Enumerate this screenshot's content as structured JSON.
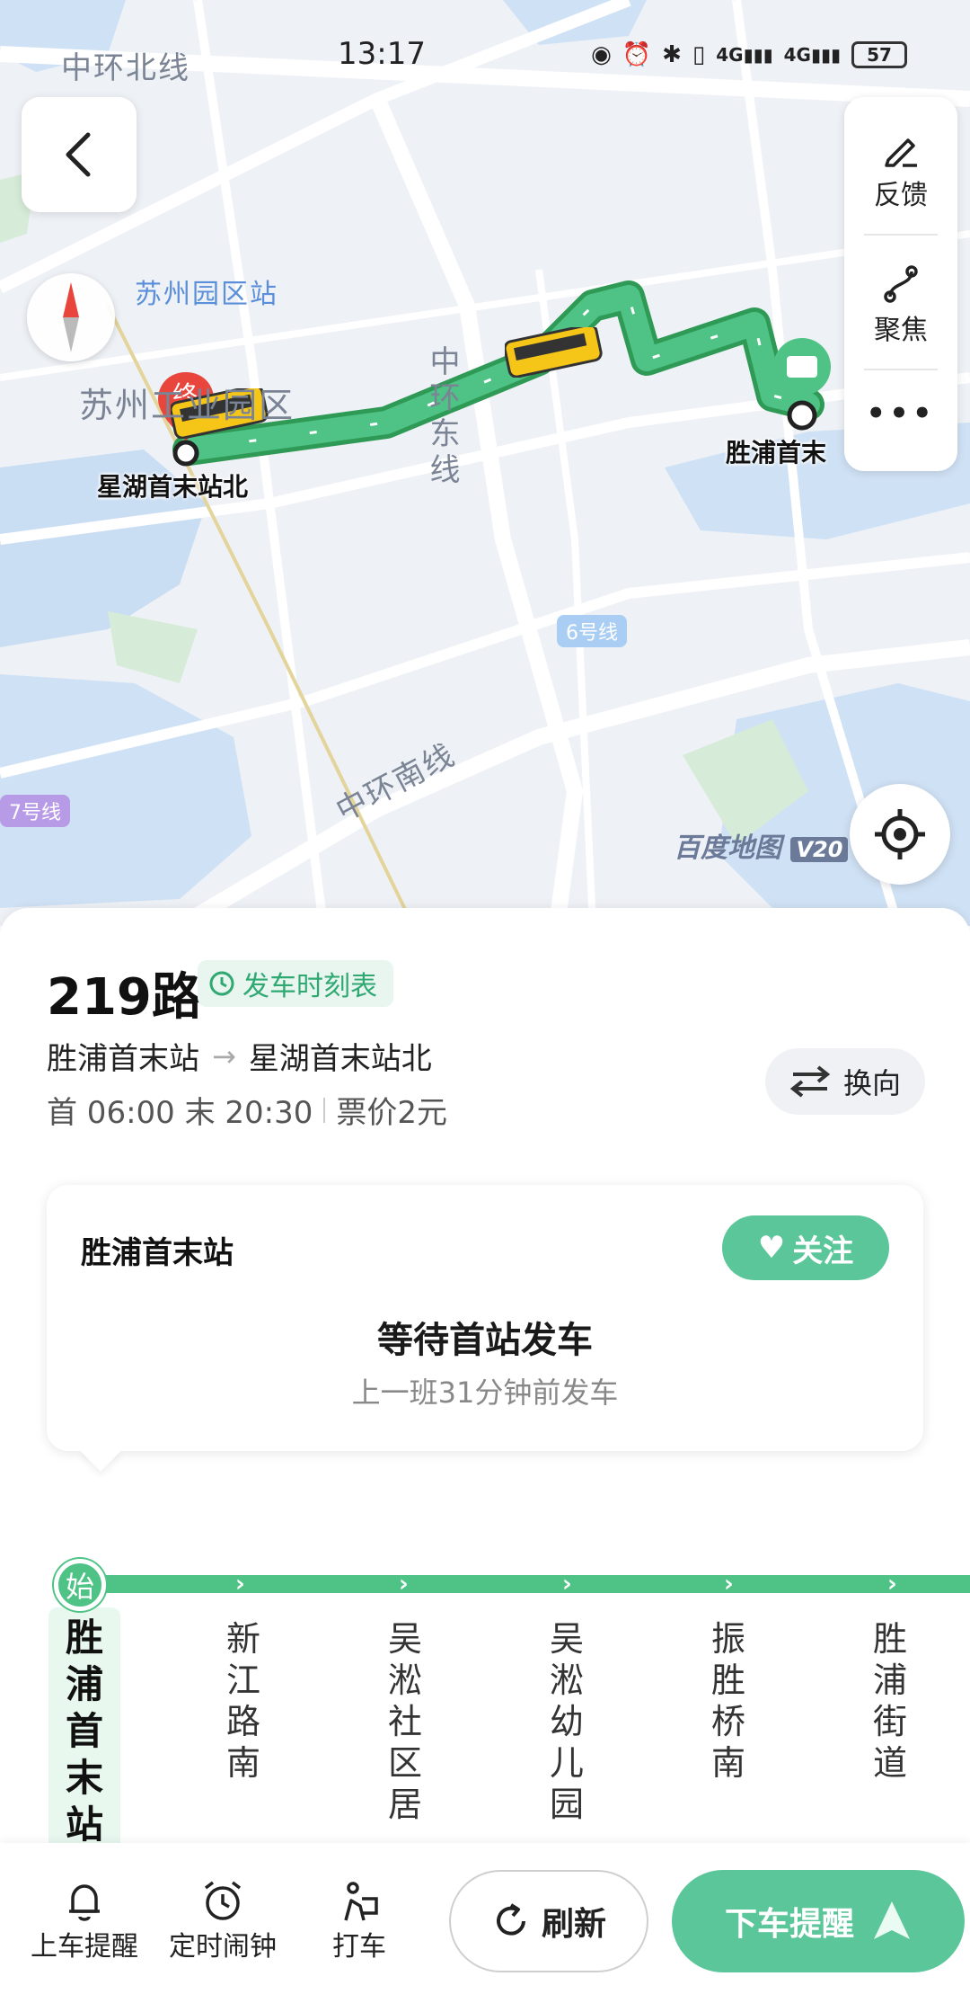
{
  "status": {
    "time": "13:17",
    "signal1": "4G",
    "signal2": "4G",
    "battery": "57"
  },
  "map": {
    "labels": {
      "zhonghuan_north": "中环北线",
      "zhonghuan_east": "中环东线",
      "zhonghuan_south": "中环南线",
      "yuanqu_station": "苏州园区站",
      "suzhou_yuanqu": "苏州工业园区",
      "line6": "6号线",
      "line7": "7号线",
      "end_marker": "终",
      "start_marker": "始"
    },
    "start_stop": "胜浦首末",
    "end_stop": "星湖首末站北",
    "logo": "百度地图",
    "logo_version": "V20",
    "colors": {
      "route": "#3fb56a",
      "bus": "#f5c518",
      "end_pin": "#e8453c",
      "start_pin": "#4fc386"
    }
  },
  "tools": {
    "feedback": "反馈",
    "focus": "聚焦",
    "more": "•••"
  },
  "route": {
    "name": "219路",
    "timetable": "发车时刻表",
    "from": "胜浦首末站",
    "to": "星湖首末站北",
    "hours": "首 06:00 末 20:30",
    "fare": "票价2元",
    "switch": "换向"
  },
  "card": {
    "station": "胜浦首末站",
    "follow": "关注",
    "status": "等待首站发车",
    "last_departure": "上一班31分钟前发车"
  },
  "timeline": {
    "start_badge": "始",
    "stops": [
      "胜浦首末站",
      "新江路南",
      "吴淞社区居委",
      "吴淞幼儿园",
      "振胜桥南",
      "胜浦街道"
    ]
  },
  "bottom": {
    "boarding_alert": "上车提醒",
    "timer_alarm": "定时闹钟",
    "taxi": "打车",
    "refresh": "刷新",
    "alight_alert": "下车提醒"
  }
}
